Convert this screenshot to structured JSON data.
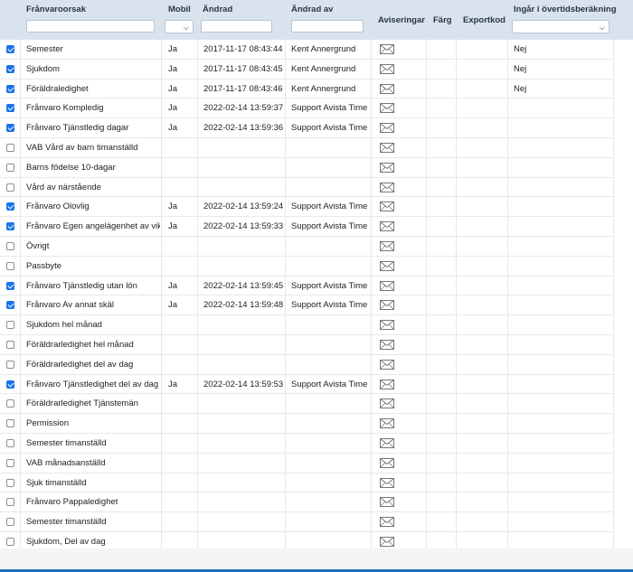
{
  "columns": {
    "reason": "Frånvaroorsak",
    "mobile": "Mobil",
    "changed": "Ändrad",
    "changed_by": "Ändrad av",
    "notifications": "Aviseringar",
    "color": "Färg",
    "export_code": "Exportkod",
    "overtime": "Ingår i övertidsberäkning"
  },
  "filters": {
    "reason": "",
    "mobile": "",
    "changed": "",
    "changed_by": "",
    "overtime": ""
  },
  "rows": [
    {
      "checked": true,
      "name": "Semester",
      "mobile": "Ja",
      "changed": "2017-11-17 08:43:44",
      "by": "Kent Annergrund",
      "overtime": "Nej"
    },
    {
      "checked": true,
      "name": "Sjukdom",
      "mobile": "Ja",
      "changed": "2017-11-17 08:43:45",
      "by": "Kent Annergrund",
      "overtime": "Nej"
    },
    {
      "checked": true,
      "name": "Föräldraledighet",
      "mobile": "Ja",
      "changed": "2017-11-17 08:43:46",
      "by": "Kent Annergrund",
      "overtime": "Nej"
    },
    {
      "checked": true,
      "name": "Frånvaro Kompledig",
      "mobile": "Ja",
      "changed": "2022-02-14 13:59:37",
      "by": "Support Avista Time",
      "overtime": ""
    },
    {
      "checked": true,
      "name": "Frånvaro Tjänstledig dagar",
      "mobile": "Ja",
      "changed": "2022-02-14 13:59:36",
      "by": "Support Avista Time",
      "overtime": ""
    },
    {
      "checked": false,
      "name": "VAB Vård av barn timanställd",
      "mobile": "",
      "changed": "",
      "by": "",
      "overtime": ""
    },
    {
      "checked": false,
      "name": "Barns födelse 10-dagar",
      "mobile": "",
      "changed": "",
      "by": "",
      "overtime": ""
    },
    {
      "checked": false,
      "name": "Vård av närstående",
      "mobile": "",
      "changed": "",
      "by": "",
      "overtime": ""
    },
    {
      "checked": true,
      "name": "Frånvaro Olovlig",
      "mobile": "Ja",
      "changed": "2022-02-14 13:59:24",
      "by": "Support Avista Time",
      "overtime": ""
    },
    {
      "checked": true,
      "name": "Frånvaro Egen angelägenhet av vikt",
      "mobile": "Ja",
      "changed": "2022-02-14 13:59:33",
      "by": "Support Avista Time",
      "overtime": ""
    },
    {
      "checked": false,
      "name": "Övrigt",
      "mobile": "",
      "changed": "",
      "by": "",
      "overtime": ""
    },
    {
      "checked": false,
      "name": "Passbyte",
      "mobile": "",
      "changed": "",
      "by": "",
      "overtime": ""
    },
    {
      "checked": true,
      "name": "Frånvaro Tjänstledig utan lön",
      "mobile": "Ja",
      "changed": "2022-02-14 13:59:45",
      "by": "Support Avista Time",
      "overtime": ""
    },
    {
      "checked": true,
      "name": "Frånvaro Av annat skäl",
      "mobile": "Ja",
      "changed": "2022-02-14 13:59:48",
      "by": "Support Avista Time",
      "overtime": ""
    },
    {
      "checked": false,
      "name": "Sjukdom hel månad",
      "mobile": "",
      "changed": "",
      "by": "",
      "overtime": ""
    },
    {
      "checked": false,
      "name": "Föräldrarledighet hel månad",
      "mobile": "",
      "changed": "",
      "by": "",
      "overtime": ""
    },
    {
      "checked": false,
      "name": "Föräldrarledighet del av dag",
      "mobile": "",
      "changed": "",
      "by": "",
      "overtime": ""
    },
    {
      "checked": true,
      "name": "Frånvaro Tjänstledighet del av dag",
      "mobile": "Ja",
      "changed": "2022-02-14 13:59:53",
      "by": "Support Avista Time",
      "overtime": ""
    },
    {
      "checked": false,
      "name": "Föräldrarledighet Tjänstemän",
      "mobile": "",
      "changed": "",
      "by": "",
      "overtime": ""
    },
    {
      "checked": false,
      "name": "Permission",
      "mobile": "",
      "changed": "",
      "by": "",
      "overtime": ""
    },
    {
      "checked": false,
      "name": "Semester timanställd",
      "mobile": "",
      "changed": "",
      "by": "",
      "overtime": ""
    },
    {
      "checked": false,
      "name": "VAB månadsanställd",
      "mobile": "",
      "changed": "",
      "by": "",
      "overtime": ""
    },
    {
      "checked": false,
      "name": "Sjuk timanställd",
      "mobile": "",
      "changed": "",
      "by": "",
      "overtime": ""
    },
    {
      "checked": false,
      "name": "Frånvaro Pappaledighet",
      "mobile": "",
      "changed": "",
      "by": "",
      "overtime": ""
    },
    {
      "checked": false,
      "name": "Semester timanställd",
      "mobile": "",
      "changed": "",
      "by": "",
      "overtime": ""
    },
    {
      "checked": false,
      "name": "Sjukdom, Del av dag",
      "mobile": "",
      "changed": "",
      "by": "",
      "overtime": ""
    }
  ],
  "icons": {
    "notification": "envelope-icon",
    "dropdown": "chevron-down-icon"
  },
  "colors": {
    "header_bg": "#d9e3ee",
    "checkbox_on": "#1a73e8",
    "accent_line": "#1e6fb8"
  }
}
